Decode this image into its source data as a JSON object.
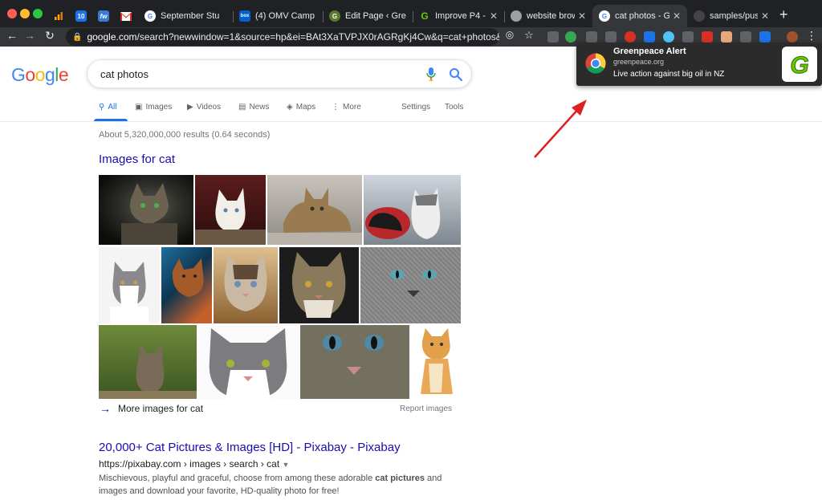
{
  "tabs": [
    {
      "title": "",
      "icon": "analytics-icon",
      "pinned": true
    },
    {
      "title": "",
      "icon": "calendar-icon",
      "pinned": true
    },
    {
      "title": "",
      "icon": "fw-icon",
      "pinned": true
    },
    {
      "title": "",
      "icon": "gmail-icon",
      "pinned": true
    },
    {
      "title": "September Stu",
      "icon": "google-icon"
    },
    {
      "title": "(4) OMV Camp",
      "icon": "box-icon"
    },
    {
      "title": "Edit Page ‹ Gre",
      "icon": "greenpeace-icon"
    },
    {
      "title": "Improve P4 - G",
      "icon": "greenpeace-icon"
    },
    {
      "title": "website brows",
      "icon": "globe-icon"
    },
    {
      "title": "cat photos - Go",
      "icon": "google-icon",
      "active": true
    },
    {
      "title": "samples/push-",
      "icon": "github-icon"
    }
  ],
  "toolbar": {
    "url_domain": "google.com",
    "url_rest": "/search?newwindow=1&source=hp&ei=BAt3XaTVPJX0rAGRgKj4Cw&q=cat+photos&oq=c..."
  },
  "search": {
    "query": "cat photos",
    "logo_letters": [
      "G",
      "o",
      "o",
      "g",
      "l",
      "e"
    ]
  },
  "nav": {
    "all": "All",
    "images": "Images",
    "videos": "Videos",
    "news": "News",
    "maps": "Maps",
    "more": "More",
    "settings": "Settings",
    "tools": "Tools"
  },
  "results": {
    "stats": "About 5,320,000,000 results (0.64 seconds)",
    "images_heading": "Images for cat",
    "more_images": "More images for cat",
    "report_images": "Report images",
    "first": {
      "title": "20,000+ Cat Pictures & Images [HD] - Pixabay - Pixabay",
      "url": "https://pixabay.com › images › search › cat",
      "snippet_pre": "Mischievous, playful and graceful, choose from among these adorable ",
      "snippet_bold": "cat pictures",
      "snippet_post": " and images and download your favorite, HD-quality photo for free!"
    }
  },
  "notification": {
    "title": "Greenpeace Alert",
    "origin": "greenpeace.org",
    "body": "Live action against big oil in NZ",
    "logo_letter": "G"
  },
  "colors": {
    "link": "#1a0dab",
    "accent": "#1a73e8",
    "greenpeace": "#66cc00",
    "annotation_arrow": "#e02020"
  }
}
